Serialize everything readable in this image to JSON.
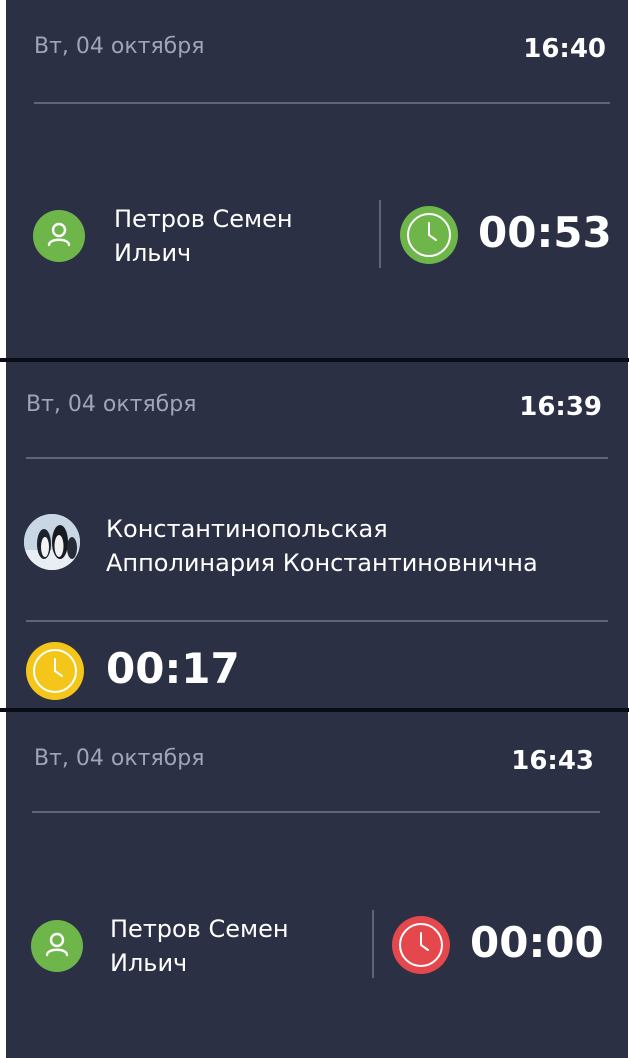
{
  "cards": [
    {
      "date": "Вт, 04 октября",
      "time": "16:40",
      "name_line1": "Петров Семен",
      "name_line2": "Ильич",
      "timer": "00:53",
      "timer_status": "green",
      "avatar": "user-icon"
    },
    {
      "date": "Вт, 04 октября",
      "time": "16:39",
      "name_line1": "Константинопольская",
      "name_line2": "Апполинария Константиновнична",
      "timer": "00:17",
      "timer_status": "yellow",
      "avatar": "penguin-photo"
    },
    {
      "date": "Вт, 04 октября",
      "time": "16:43",
      "name_line1": "Петров Семен",
      "name_line2": "Ильич",
      "timer": "00:00",
      "timer_status": "red",
      "avatar": "user-icon"
    }
  ],
  "colors": {
    "card_bg": "#2b3045",
    "date_text": "#9fa4b6",
    "divider": "#5f6579",
    "green": "#6eb64a",
    "yellow": "#f5c61a",
    "red": "#e4484d"
  }
}
